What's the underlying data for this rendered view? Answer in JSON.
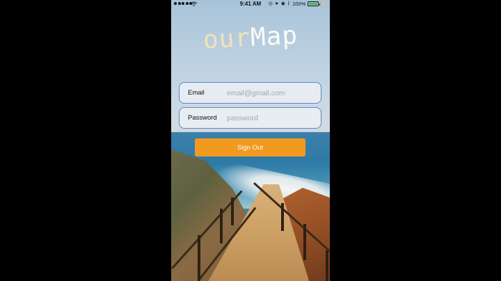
{
  "status_bar": {
    "time": "9:41 AM",
    "battery": "100%"
  },
  "logo": {
    "part1": "our",
    "part2": "Map"
  },
  "form": {
    "email_label": "Email",
    "email_placeholder": "email@gmail.com",
    "password_label": "Password",
    "password_placeholder": "password",
    "signout_label": "Sign Out"
  },
  "colors": {
    "button": "#f29a1f",
    "field_border": "#5e86c9"
  },
  "icons": [
    "signal-icon",
    "wifi-icon",
    "alarm-icon",
    "location-icon",
    "lock-icon",
    "bluetooth-icon",
    "battery-icon",
    "charging-icon"
  ]
}
